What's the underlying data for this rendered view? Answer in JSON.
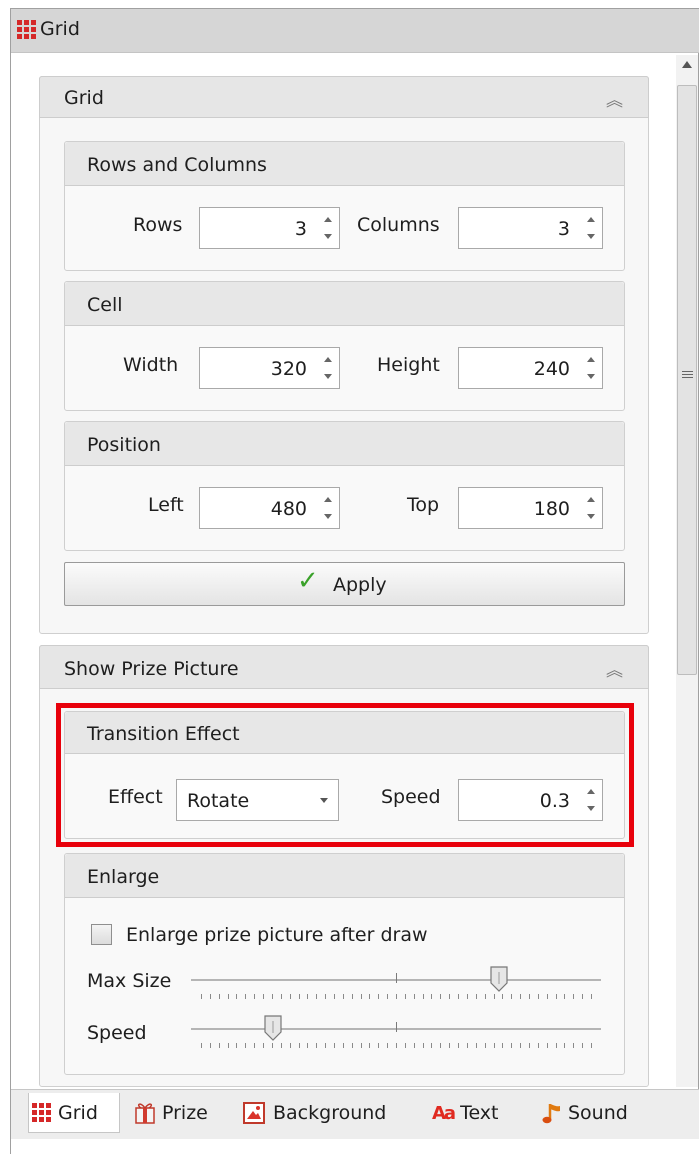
{
  "window": {
    "title": "Grid"
  },
  "grid_panel": {
    "header": "Grid",
    "rows_columns": {
      "title": "Rows and Columns",
      "rows_label": "Rows",
      "rows_value": "3",
      "columns_label": "Columns",
      "columns_value": "3"
    },
    "cell": {
      "title": "Cell",
      "width_label": "Width",
      "width_value": "320",
      "height_label": "Height",
      "height_value": "240"
    },
    "position": {
      "title": "Position",
      "left_label": "Left",
      "left_value": "480",
      "top_label": "Top",
      "top_value": "180"
    },
    "apply_label": "Apply"
  },
  "prize_panel": {
    "header": "Show Prize Picture",
    "transition": {
      "title": "Transition Effect",
      "effect_label": "Effect",
      "effect_value": "Rotate",
      "speed_label": "Speed",
      "speed_value": "0.3"
    },
    "enlarge": {
      "title": "Enlarge",
      "checkbox_label": "Enlarge prize picture after draw",
      "checked": false,
      "max_size_label": "Max Size",
      "max_size_level": 0.75,
      "speed_label": "Speed",
      "speed_level": 0.2
    }
  },
  "tabs": [
    {
      "label": "Grid",
      "icon": "grid-icon",
      "active": true
    },
    {
      "label": "Prize",
      "icon": "gift-icon"
    },
    {
      "label": "Background",
      "icon": "picture-icon"
    },
    {
      "label": "Text",
      "icon": "font-icon"
    },
    {
      "label": "Sound",
      "icon": "music-note-icon"
    }
  ],
  "colors": {
    "highlight": "#e8000b",
    "grid_icon": "#d52828",
    "check": "#3aa12a"
  }
}
